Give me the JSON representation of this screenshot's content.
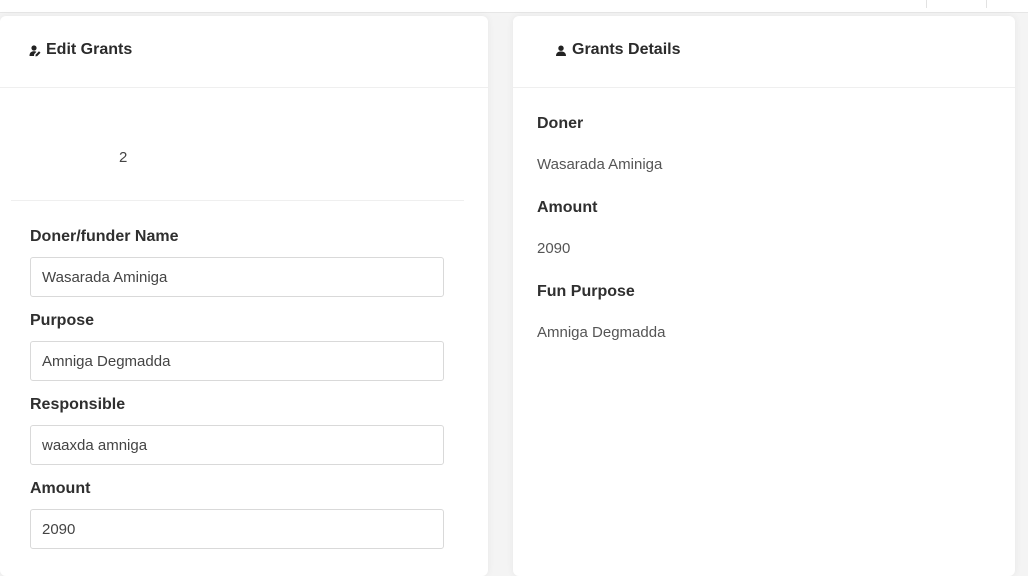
{
  "edit_card": {
    "title": "Edit Grants",
    "icon": "user-edit-icon",
    "grant_id": "2",
    "fields": [
      {
        "label": "Doner/funder Name",
        "value": "Wasarada Aminiga"
      },
      {
        "label": "Purpose",
        "value": "Amniga Degmadda"
      },
      {
        "label": "Responsible",
        "value": "waaxda amniga"
      },
      {
        "label": "Amount",
        "value": "2090"
      }
    ]
  },
  "details_card": {
    "title": "Grants Details",
    "icon": "user-icon",
    "items": [
      {
        "label": "Doner",
        "value": "Wasarada Aminiga"
      },
      {
        "label": "Amount",
        "value": "2090"
      },
      {
        "label": "Fun Purpose",
        "value": "Amniga Degmadda"
      }
    ]
  }
}
